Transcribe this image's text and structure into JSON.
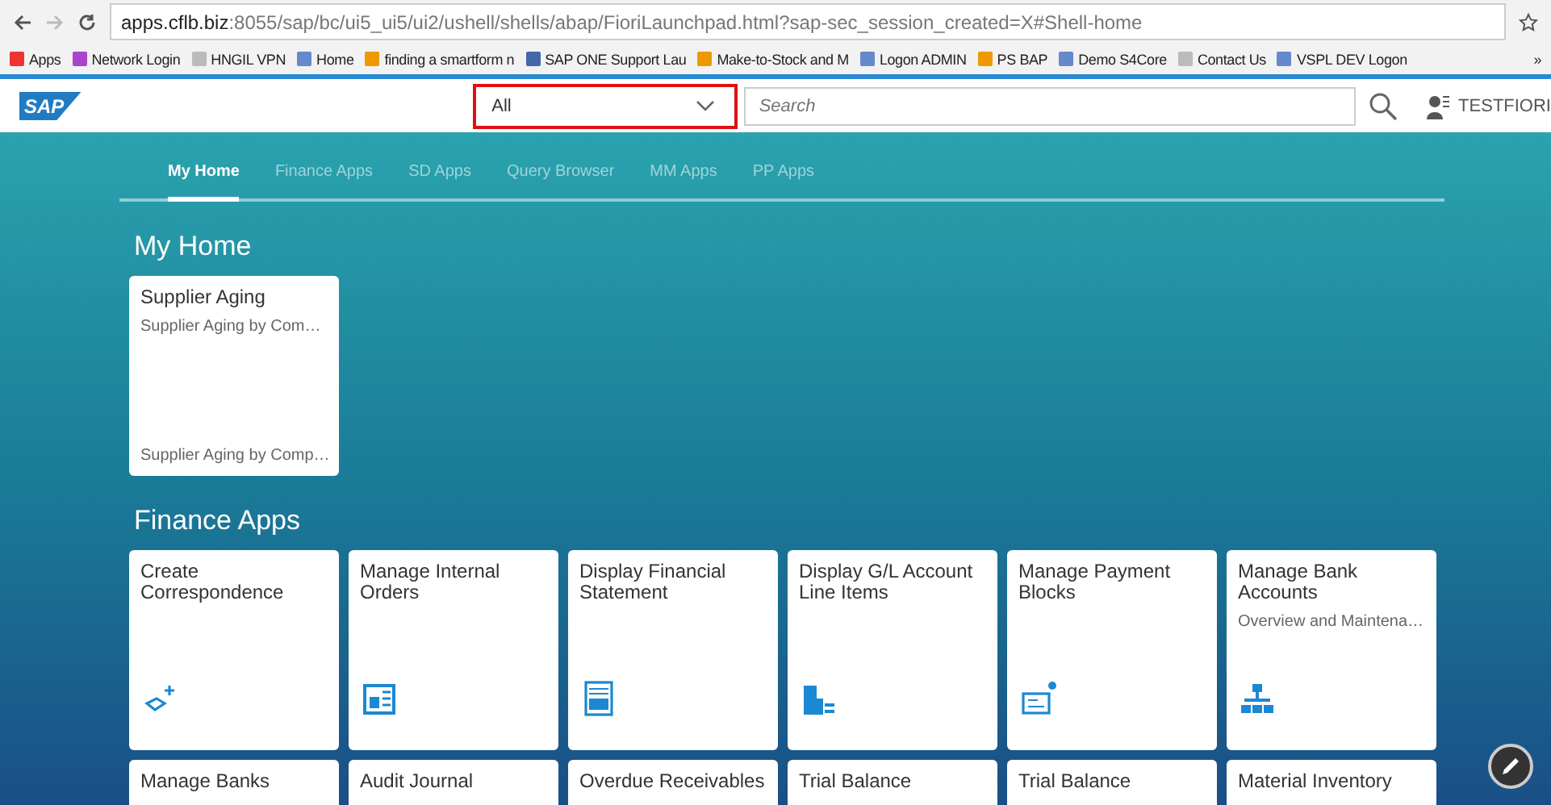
{
  "browser": {
    "url_host": "apps.cflb.biz",
    "url_rest": ":8055/sap/bc/ui5_ui5/ui2/ushell/shells/abap/FioriLaunchpad.html?sap-sec_session_created=X#Shell-home",
    "bookmarks": [
      "Apps",
      "Network Login",
      "HNGIL VPN",
      "Home",
      "finding a smartform n",
      "SAP ONE Support Lau",
      "Make-to-Stock and M",
      "Logon ADMIN",
      "PS BAP",
      "Demo S4Core",
      "Contact Us",
      "VSPL DEV Logon"
    ],
    "more": "»"
  },
  "shell": {
    "logo": "SAP",
    "scope": "All",
    "search": {
      "placeholder": "Search"
    },
    "user": "TESTFIORI"
  },
  "tabs": [
    {
      "label": "My Home",
      "selected": true
    },
    {
      "label": "Finance Apps",
      "selected": false
    },
    {
      "label": "SD Apps",
      "selected": false
    },
    {
      "label": "Query Browser",
      "selected": false
    },
    {
      "label": "MM Apps",
      "selected": false
    },
    {
      "label": "PP Apps",
      "selected": false
    }
  ],
  "groups": [
    {
      "title": "My Home",
      "tiles": [
        {
          "title": "Supplier Aging",
          "subtitle": "Supplier Aging by Com…",
          "footer": "Supplier Aging by Comp…"
        }
      ]
    },
    {
      "title": "Finance Apps",
      "tiles": [
        {
          "title": "Create Correspondence"
        },
        {
          "title": "Manage Internal Orders"
        },
        {
          "title": "Display Financial Statement"
        },
        {
          "title": "Display G/L Account Line Items"
        },
        {
          "title": "Manage Payment Blocks"
        },
        {
          "title": "Manage Bank Accounts",
          "subtitle": "Overview and Maintena…"
        },
        {
          "title": "Manage Banks"
        },
        {
          "title": "Audit Journal"
        },
        {
          "title": "Overdue Receivables"
        },
        {
          "title": "Trial Balance"
        },
        {
          "title": "Trial Balance"
        },
        {
          "title": "Material Inventory"
        }
      ]
    }
  ]
}
